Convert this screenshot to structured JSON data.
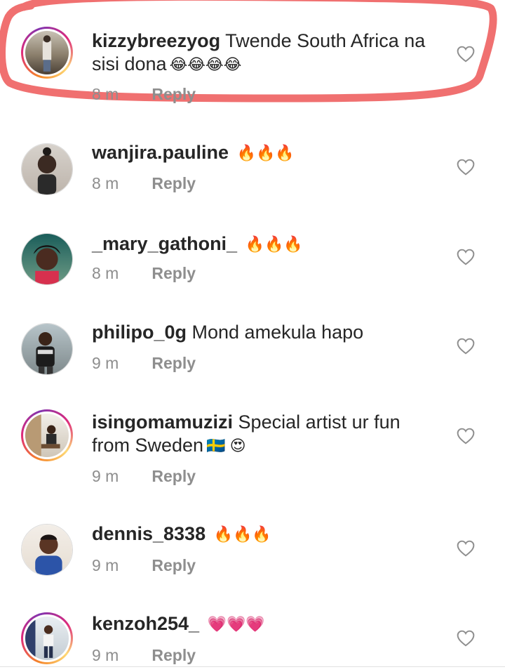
{
  "comments": [
    {
      "username": "kizzybreezyog",
      "text": "Twende South Africa na sisi dona",
      "emoji": "😂😂😂😂",
      "time": "8 m",
      "reply": "Reply",
      "icon": "heart-outline-icon"
    },
    {
      "username": "wanjira.pauline",
      "text": "",
      "emoji": "🔥🔥🔥",
      "time": "8 m",
      "reply": "Reply",
      "icon": "heart-outline-icon"
    },
    {
      "username": "_mary_gathoni_",
      "text": "",
      "emoji": "🔥🔥🔥",
      "time": "8 m",
      "reply": "Reply",
      "icon": "heart-outline-icon"
    },
    {
      "username": "philipo_0g",
      "text": "Mond amekula hapo",
      "emoji": "",
      "time": "9 m",
      "reply": "Reply",
      "icon": "heart-outline-icon"
    },
    {
      "username": "isingomamuzizi",
      "text": "Special artist ur fun from Sweden",
      "emoji": "🇸🇪 😍",
      "time": "9 m",
      "reply": "Reply",
      "icon": "heart-outline-icon"
    },
    {
      "username": "dennis_8338",
      "text": "",
      "emoji": "🔥🔥🔥",
      "time": "9 m",
      "reply": "Reply",
      "icon": "heart-outline-icon"
    },
    {
      "username": "kenzoh254_",
      "text": "",
      "emoji": "💗💗💗",
      "time": "9 m",
      "reply": "Reply",
      "icon": "heart-outline-icon"
    }
  ],
  "colors": {
    "highlight": "#f07070",
    "username": "#262626",
    "meta": "#8e8e8e"
  }
}
